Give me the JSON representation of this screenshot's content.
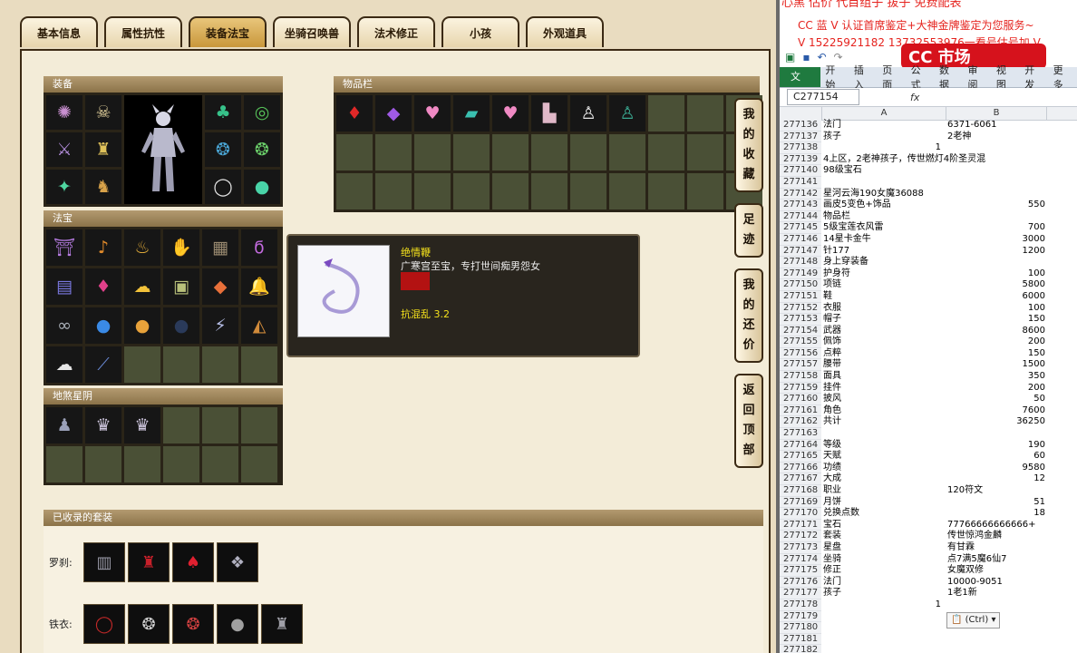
{
  "tabs": [
    "基本信息",
    "属性抗性",
    "装备法宝",
    "坐骑召唤兽",
    "法术修正",
    "小孩",
    "外观道具"
  ],
  "active_tab": 2,
  "sections": {
    "equip": "装备",
    "fabao": "法宝",
    "mount": "地煞星阴",
    "inventory": "物品栏",
    "suits": "已收录的套装"
  },
  "side_buttons": [
    {
      "label": [
        "我",
        "的",
        "收",
        "藏"
      ]
    },
    {
      "label": [
        "足",
        "迹"
      ]
    },
    {
      "label": [
        "我",
        "的",
        "还",
        "价"
      ]
    },
    {
      "label": [
        "返",
        "回",
        "顶",
        "部"
      ]
    }
  ],
  "tooltip": {
    "name": "绝情鞭",
    "desc": "广寒宫至宝，专打世间痴男怨女",
    "stat": "抗混乱 3.2"
  },
  "suits": [
    {
      "label": "罗刹:",
      "count": 4
    },
    {
      "label": "铁衣:",
      "count": 5
    }
  ],
  "banner": {
    "line1": "心黑 估价 代目组子 拔子 免费配表",
    "line2": "CC 蓝 V 认证首席鉴定+大神金牌鉴定为您服务~",
    "line3": "V 15225921182      13732553976一看号估号加 V",
    "logo": "CC 市场"
  },
  "excel": {
    "ribbon_tabs": [
      "文件",
      "开始",
      "插入",
      "页面",
      "公式",
      "数据",
      "审阅",
      "视图",
      "开发",
      "更多"
    ],
    "namebox": "C277154",
    "fx": "fx",
    "col_a": "A",
    "col_b": "B",
    "ctrl_label": "(Ctrl)",
    "rows": [
      {
        "n": "277136",
        "a": "法门",
        "b": "6371-6061",
        "bnum": false
      },
      {
        "n": "277137",
        "a": "孩子",
        "b": "2老神",
        "bnum": false
      },
      {
        "n": "277138",
        "a": "1",
        "b": "",
        "anum": true
      },
      {
        "n": "277139",
        "a": "4上区，2老神孩子，传世燃灯4阶圣灵混",
        "b": ""
      },
      {
        "n": "277140",
        "a": "98级宝石",
        "b": ""
      },
      {
        "n": "277141",
        "a": "",
        "b": ""
      },
      {
        "n": "277142",
        "a": "星河云海190女魔36088",
        "b": ""
      },
      {
        "n": "277143",
        "a": "画皮5变色+饰品",
        "b": "550",
        "bnum": true
      },
      {
        "n": "277144",
        "a": "物品栏",
        "b": ""
      },
      {
        "n": "277145",
        "a": "5级宝莲衣风雷",
        "b": "700",
        "bnum": true
      },
      {
        "n": "277146",
        "a": "14星卡金牛",
        "b": "3000",
        "bnum": true
      },
      {
        "n": "277147",
        "a": "针177",
        "b": "1200",
        "bnum": true
      },
      {
        "n": "277148",
        "a": "身上穿装备",
        "b": ""
      },
      {
        "n": "277149",
        "a": "护身符",
        "b": "100",
        "bnum": true
      },
      {
        "n": "277150",
        "a": "项链",
        "b": "5800",
        "bnum": true
      },
      {
        "n": "277151",
        "a": "鞋",
        "b": "6000",
        "bnum": true
      },
      {
        "n": "277152",
        "a": "衣服",
        "b": "100",
        "bnum": true
      },
      {
        "n": "277153",
        "a": "帽子",
        "b": "150",
        "bnum": true
      },
      {
        "n": "277154",
        "a": "武器",
        "b": "8600",
        "bnum": true
      },
      {
        "n": "277155",
        "a": "佩饰",
        "b": "200",
        "bnum": true
      },
      {
        "n": "277156",
        "a": "点粹",
        "b": "150",
        "bnum": true
      },
      {
        "n": "277157",
        "a": "腰带",
        "b": "1500",
        "bnum": true
      },
      {
        "n": "277158",
        "a": "面具",
        "b": "350",
        "bnum": true
      },
      {
        "n": "277159",
        "a": "挂件",
        "b": "200",
        "bnum": true
      },
      {
        "n": "277160",
        "a": "披风",
        "b": "50",
        "bnum": true
      },
      {
        "n": "277161",
        "a": "角色",
        "b": "7600",
        "bnum": true
      },
      {
        "n": "277162",
        "a": "共计",
        "b": "36250",
        "bnum": true
      },
      {
        "n": "277163",
        "a": "",
        "b": ""
      },
      {
        "n": "277164",
        "a": "等级",
        "b": "190",
        "bnum": true
      },
      {
        "n": "277165",
        "a": "天赋",
        "b": "60",
        "bnum": true
      },
      {
        "n": "277166",
        "a": "功绩",
        "b": "9580",
        "bnum": true
      },
      {
        "n": "277167",
        "a": "大成",
        "b": "12",
        "bnum": true
      },
      {
        "n": "277168",
        "a": "职业",
        "b": "120符文",
        "bnum": false
      },
      {
        "n": "277169",
        "a": "月饼",
        "b": "51",
        "bnum": true
      },
      {
        "n": "277170",
        "a": "兑换点数",
        "b": "18",
        "bnum": true
      },
      {
        "n": "277171",
        "a": "宝石",
        "b": "77766666666666+",
        "bnum": false
      },
      {
        "n": "277172",
        "a": "套装",
        "b": "传世惊鸿金麟",
        "bnum": false
      },
      {
        "n": "277173",
        "a": "星盘",
        "b": "有甘霖",
        "bnum": false
      },
      {
        "n": "277174",
        "a": "坐骑",
        "b": "点7满5魔6仙7",
        "bnum": false
      },
      {
        "n": "277175",
        "a": "修正",
        "b": "女魔双修",
        "bnum": false
      },
      {
        "n": "277176",
        "a": "法门",
        "b": "10000-9051",
        "bnum": false
      },
      {
        "n": "277177",
        "a": "孩子",
        "b": "1老1新",
        "bnum": false
      },
      {
        "n": "277178",
        "a": "1",
        "b": "",
        "anum": true
      },
      {
        "n": "277179",
        "a": "",
        "b": ""
      },
      {
        "n": "277180",
        "a": "",
        "b": ""
      },
      {
        "n": "277181",
        "a": "",
        "b": ""
      },
      {
        "n": "277182",
        "a": "",
        "b": ""
      }
    ]
  }
}
